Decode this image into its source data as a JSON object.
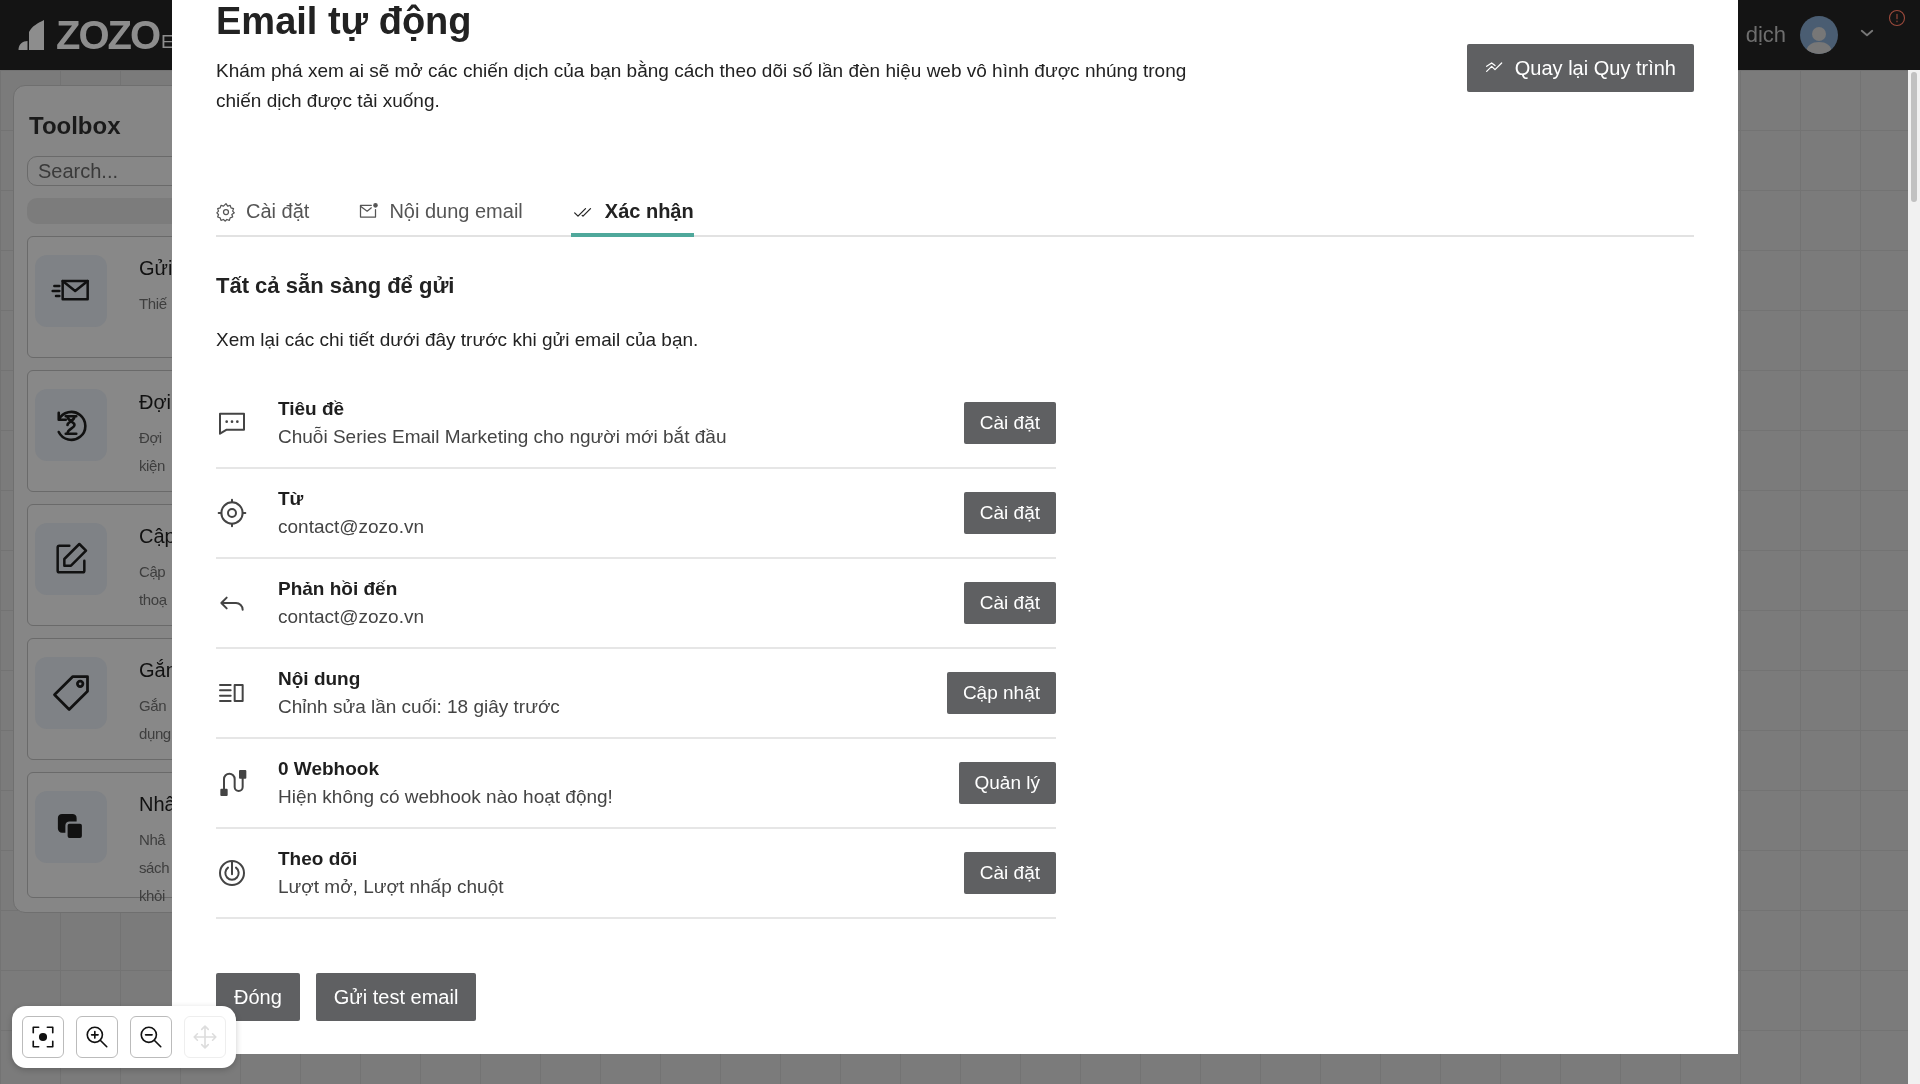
{
  "app_header": {
    "logo": "ZOZO",
    "logo_suffix": "E",
    "nav_text": "dịch"
  },
  "toolbox": {
    "title": "Toolbox",
    "search": {
      "placeholder": "Search..."
    },
    "items": [
      {
        "title": "Gửi",
        "description": [
          "Thiế"
        ]
      },
      {
        "title": "Đợi",
        "description": [
          "Đợi",
          "kiện"
        ]
      },
      {
        "title": "Cập",
        "description": [
          "Cập",
          "thoạ"
        ]
      },
      {
        "title": "Gắn",
        "description": [
          "Gắn",
          "dụng"
        ]
      },
      {
        "title": "Nhâ",
        "description": [
          "Nhâ",
          "sách",
          "khỏi"
        ]
      }
    ]
  },
  "modal": {
    "title": "Email tự động",
    "description": "Khám phá xem ai sẽ mở các chiến dịch của bạn bằng cách theo dõi số lần đèn hiệu web vô hình được nhúng trong chiến dịch được tải xuống.",
    "back_button": "Quay lại Quy trình",
    "tabs": [
      {
        "label": "Cài đặt",
        "selected": false
      },
      {
        "label": "Nội dung email",
        "selected": false
      },
      {
        "label": "Xác nhận",
        "selected": true
      }
    ],
    "heading": "Tất cả sẵn sàng để gửi",
    "subtitle": "Xem lại các chi tiết dưới đây trước khi gửi email của bạn.",
    "items": [
      {
        "title": "Tiêu đề",
        "value": "Chuỗi Series Email Marketing cho người mới bắt đầu",
        "button": "Cài đặt"
      },
      {
        "title": "Từ",
        "value": "contact@zozo.vn",
        "button": "Cài đặt"
      },
      {
        "title": "Phản hồi đến",
        "value": "contact@zozo.vn",
        "button": "Cài đặt"
      },
      {
        "title": "Nội dung",
        "value": "Chỉnh sửa lần cuối: 18 giây trước",
        "button": "Cập nhật"
      },
      {
        "title": "0 Webhook",
        "value": "Hiện không có webhook nào hoạt động!",
        "button": "Quản lý"
      },
      {
        "title": "Theo dõi",
        "value": "Lượt mở, Lượt nhấp chuột",
        "button": "Cài đặt"
      }
    ],
    "buttons": [
      "Đóng",
      "Gửi test email"
    ]
  },
  "zoom_controls": [
    {
      "disabled": false
    },
    {
      "disabled": false
    },
    {
      "disabled": false
    },
    {
      "disabled": true
    }
  ]
}
